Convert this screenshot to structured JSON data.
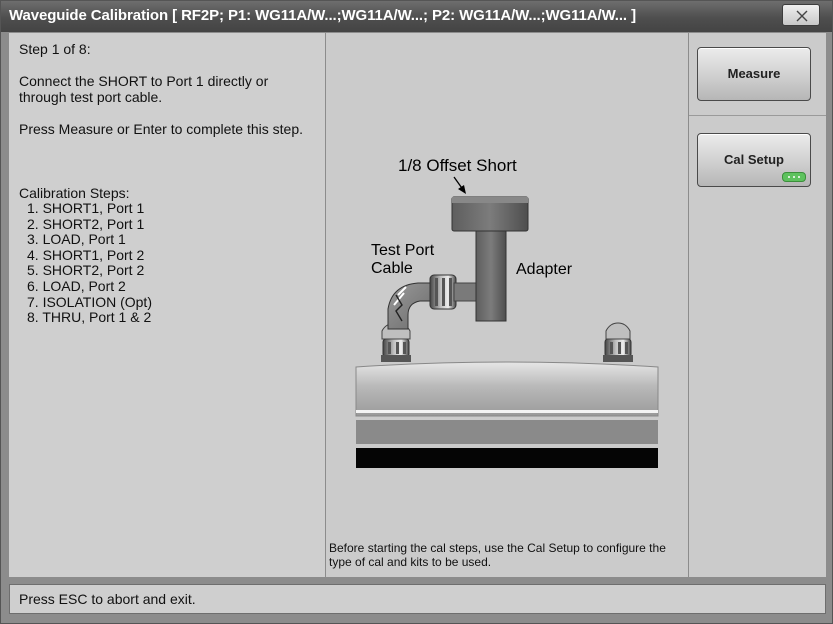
{
  "window": {
    "title": "Waveguide Calibration [ RF2P; P1: WG11A/W...;WG11A/W...; P2: WG11A/W...;WG11A/W... ]",
    "close_icon": "close-icon"
  },
  "instructions": {
    "step": "Step 1 of 8:",
    "connect": "Connect the SHORT to Port 1 directly or through test port cable.",
    "press": "Press Measure or Enter to complete this step.",
    "steps_header": "Calibration Steps:",
    "steps": [
      "1. SHORT1, Port 1",
      "2. SHORT2, Port 1",
      "3. LOAD, Port 1",
      "4. SHORT1, Port 2",
      "5. SHORT2, Port 2",
      "6. LOAD, Port 2",
      "7. ISOLATION (Opt)",
      "8. THRU, Port 1 & 2"
    ]
  },
  "diagram": {
    "offset_short_label": "1/8 Offset Short",
    "test_port_label_1": "Test Port",
    "test_port_label_2": "Cable",
    "adapter_label": "Adapter"
  },
  "note": "Before starting the cal steps, use the Cal Setup to configure the type of cal and kits to be used.",
  "softkeys": {
    "measure": "Measure",
    "cal_setup": "Cal Setup",
    "more_indicator_color": "#5ec25e"
  },
  "status": "Press ESC to abort and exit."
}
